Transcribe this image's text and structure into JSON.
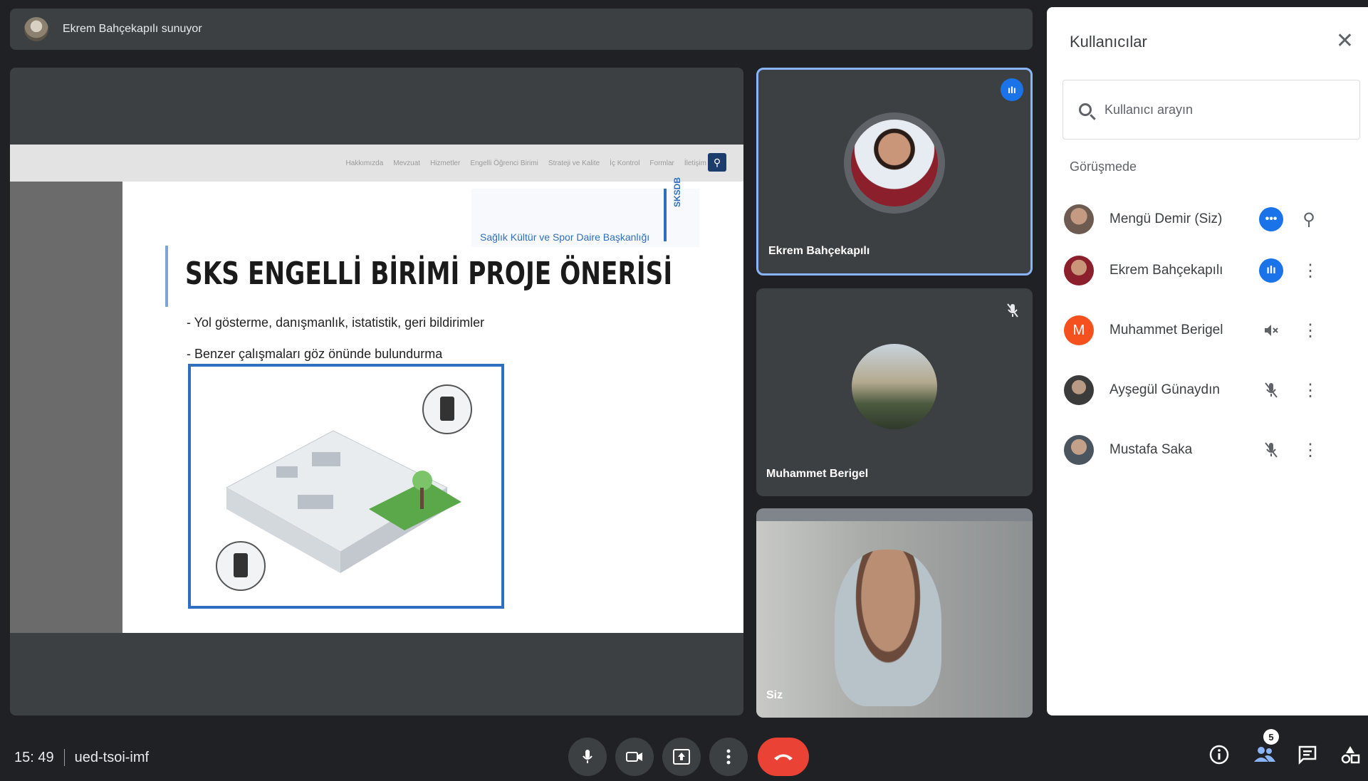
{
  "presenter": {
    "text": "Ekrem Bahçekapılı sunuyor"
  },
  "slide": {
    "nav": [
      "Hakkımızda",
      "Mevzuat",
      "Hizmetler",
      "Engelli Öğrenci Birimi",
      "Strateji ve Kalite",
      "İç Kontrol",
      "Formlar",
      "İletişim"
    ],
    "department": "Sağlık Kültür ve Spor Daire Başkanlığı",
    "department_abbr": "SKSDB",
    "title": "SKS ENGELLİ BİRİMİ PROJE ÖNERİSİ",
    "bullets": [
      "- Yol gösterme, danışmanlık, istatistik, geri bildirimler",
      "- Benzer çalışmaları göz önünde bulundurma"
    ]
  },
  "tiles": {
    "ekrem": {
      "name": "Ekrem Bahçekapılı"
    },
    "muhammet": {
      "name": "Muhammet Berigel"
    },
    "self": {
      "name": "Siz"
    }
  },
  "panel": {
    "title": "Kullanıcılar",
    "close": "✕",
    "search_placeholder": "Kullanıcı arayın",
    "section_label": "Görüşmede",
    "users": [
      {
        "name": "Mengü Demir (Siz)",
        "status": "more",
        "status_glyph": "•••",
        "action_icon": "pin-icon",
        "action_glyph": "⚲"
      },
      {
        "name": "Ekrem Bahçekapılı",
        "status": "speaking",
        "status_glyph": "ıIı",
        "action_icon": "more-vert-icon",
        "action_glyph": "⋮"
      },
      {
        "name": "Muhammet Berigel",
        "initial": "M",
        "status": "muted",
        "status_glyph": "🔇",
        "action_icon": "more-vert-icon",
        "action_glyph": "⋮"
      },
      {
        "name": "Ayşegül Günaydın",
        "status": "mic-off",
        "status_glyph": "🎙",
        "action_icon": "more-vert-icon",
        "action_glyph": "⋮"
      },
      {
        "name": "Mustafa Saka",
        "status": "mic-off",
        "status_glyph": "🎙",
        "action_icon": "more-vert-icon",
        "action_glyph": "⋮"
      }
    ]
  },
  "bottom": {
    "time": "15: 49",
    "meeting_code": "ued-tsoi-imf",
    "people_count": "5"
  },
  "colors": {
    "accent": "#1a73e8",
    "end_call": "#ea4335",
    "avatar_m": "#f4511e"
  }
}
